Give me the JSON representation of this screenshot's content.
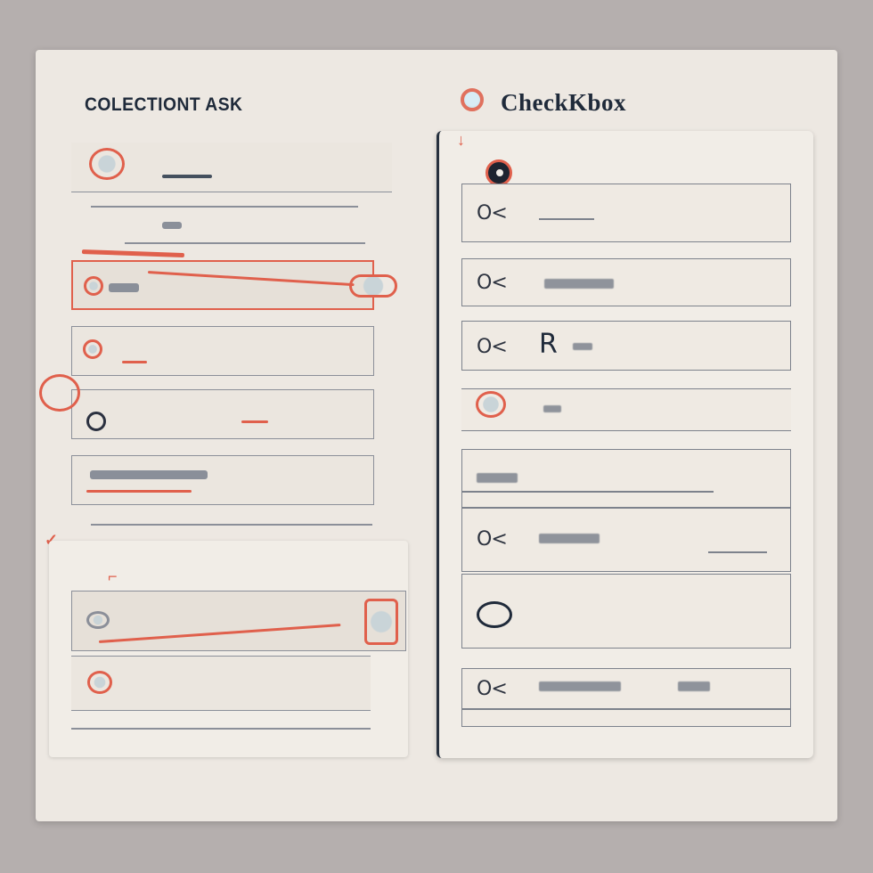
{
  "left_panel": {
    "title": "COLECTIONT ASK",
    "rows": [
      {
        "id": "row-1"
      },
      {
        "id": "row-2"
      },
      {
        "id": "row-3"
      },
      {
        "id": "row-4"
      },
      {
        "id": "row-5"
      },
      {
        "id": "row-6"
      },
      {
        "id": "row-7"
      },
      {
        "id": "row-8"
      }
    ]
  },
  "right_panel": {
    "title": "CheckKbox",
    "rows": [
      {
        "glyph": "O<"
      },
      {
        "glyph": "O<"
      },
      {
        "glyph": "O<",
        "extra": "R"
      },
      {
        "glyph": ""
      },
      {
        "glyph": ""
      },
      {
        "glyph": "O<"
      },
      {
        "glyph": ""
      },
      {
        "glyph": "O<"
      }
    ]
  },
  "colors": {
    "accent": "#e0604c",
    "ink": "#1f2a3a",
    "board": "#ede8e2",
    "backdrop": "#b5afae"
  },
  "icons": {
    "title_marker": "radio-icon",
    "row_marker": "radio-ring-icon",
    "row_glyph": "chevron-left-icon"
  }
}
